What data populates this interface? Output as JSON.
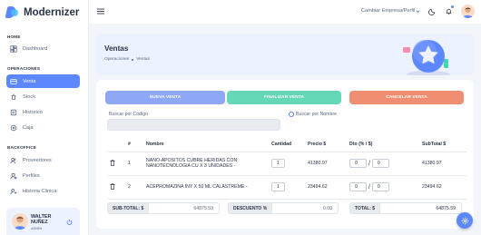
{
  "brand": {
    "name": "Modernizer"
  },
  "sidebar": {
    "sections": {
      "home": "HOME",
      "operations": "OPERACIONES",
      "backoffice": "BACKOFFICE"
    },
    "items": [
      {
        "label": "Dashboard",
        "icon": "layout-dashboard-icon"
      },
      {
        "label": "Venta",
        "icon": "shopping-cart-icon",
        "active": true
      },
      {
        "label": "Stock",
        "icon": "package-icon"
      },
      {
        "label": "Historico",
        "icon": "history-icon"
      },
      {
        "label": "Caja",
        "icon": "cash-register-icon"
      },
      {
        "label": "Proveedores",
        "icon": "users-icon"
      },
      {
        "label": "Perfiles",
        "icon": "user-settings-icon"
      },
      {
        "label": "Historia Clinica",
        "icon": "medical-record-icon"
      }
    ],
    "user": {
      "name": "WALTER NUÑEZ",
      "role": "ADMIN"
    }
  },
  "header": {
    "company_select": "Cambiar Empresa/Perfil"
  },
  "page": {
    "title": "Ventas",
    "breadcrumb": [
      "Operaciones",
      "Ventas"
    ]
  },
  "actions": {
    "new_sale": "NUEVA VENTA",
    "finish_sale": "FINALIZAR VENTA",
    "cancel_sale": "CANCELAR VENTA"
  },
  "search": {
    "by_code_label": "Buscar por Código",
    "by_name_label": "Buscar por Nombre",
    "code_value": ""
  },
  "table": {
    "headers": [
      "#",
      "Nombre",
      "Cantidad",
      "Precio $",
      "Dto (% / $)",
      "SubTotal $"
    ],
    "rows": [
      {
        "index": "1",
        "name": "NANO-APOSITOS CUBRE HERIDAS CON NANOTECNOLOGIA CU X 3 UNIDADES -",
        "qty": "1",
        "price": "41380.97",
        "dto_pct": "0",
        "dto_amount": "0",
        "subtotal": "41380.97"
      },
      {
        "index": "2",
        "name": "ACEPROMAZINA INY X 50 ML CALASTREME -",
        "qty": "1",
        "price": "23494.62",
        "dto_pct": "0",
        "dto_amount": "0",
        "subtotal": "23494.62"
      }
    ]
  },
  "totals": {
    "subtotal_label": "SUB-TOTAL: $",
    "subtotal_value": "64875.59",
    "discount_label": "DESCUENTO %",
    "discount_value": "0.00",
    "total_label": "TOTAL: $",
    "total_value": "64875.59"
  },
  "colors": {
    "primary": "#5d87ff",
    "success": "#64d8b6",
    "danger": "#f08e72",
    "new_sale": "#8fa8f5"
  }
}
